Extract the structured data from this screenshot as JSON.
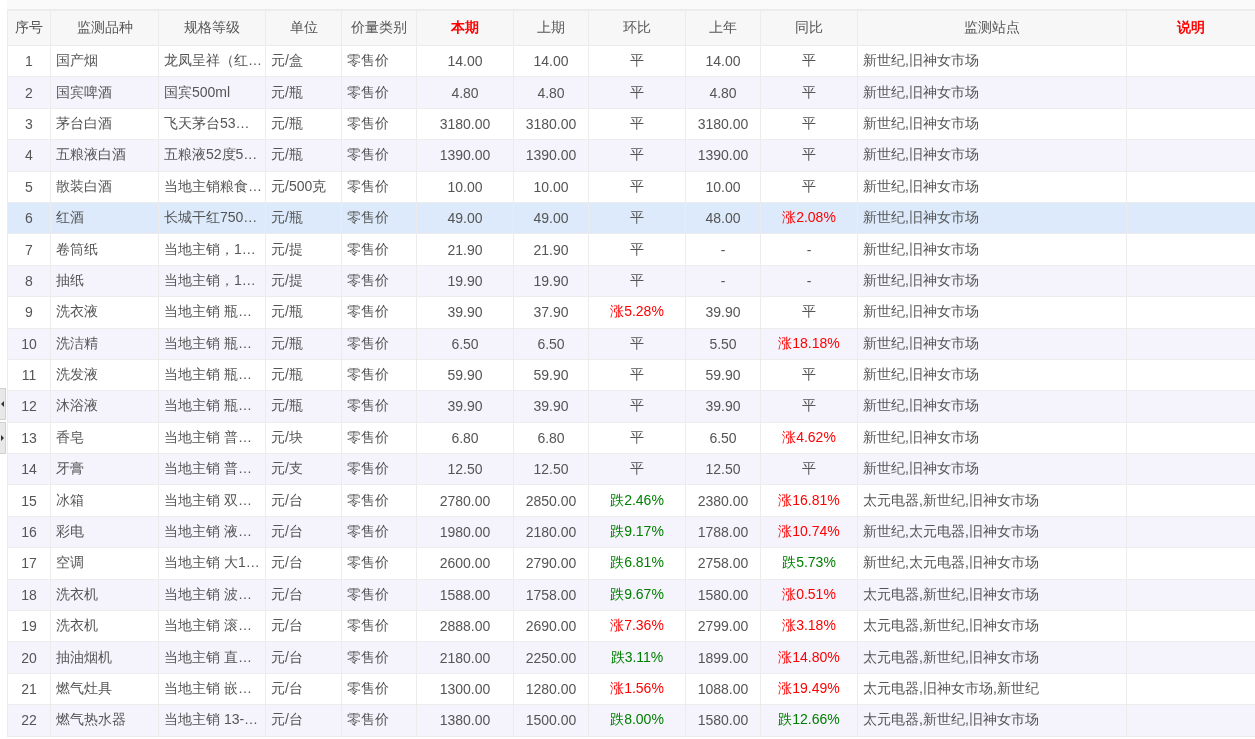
{
  "table": {
    "columns": [
      {
        "label": "序号",
        "emphasized": false
      },
      {
        "label": "监测品种",
        "emphasized": false
      },
      {
        "label": "规格等级",
        "emphasized": false
      },
      {
        "label": "单位",
        "emphasized": false
      },
      {
        "label": "价量类别",
        "emphasized": false
      },
      {
        "label": "本期",
        "emphasized": true
      },
      {
        "label": "上期",
        "emphasized": false
      },
      {
        "label": "环比",
        "emphasized": false
      },
      {
        "label": "上年",
        "emphasized": false
      },
      {
        "label": "同比",
        "emphasized": false
      },
      {
        "label": "监测站点",
        "emphasized": false
      },
      {
        "label": "说明",
        "emphasized": true
      }
    ],
    "rows": [
      {
        "selected": false,
        "cells": [
          "1",
          "国产烟",
          "龙凤呈祥（红…",
          "元/盒",
          "零售价",
          "14.00",
          "14.00",
          {
            "text": "平",
            "kind": "flat"
          },
          "14.00",
          {
            "text": "平",
            "kind": "flat"
          },
          "新世纪,旧神女市场"
        ]
      },
      {
        "selected": false,
        "cells": [
          "2",
          "国宾啤酒",
          "国宾500ml",
          "元/瓶",
          "零售价",
          "4.80",
          "4.80",
          {
            "text": "平",
            "kind": "flat"
          },
          "4.80",
          {
            "text": "平",
            "kind": "flat"
          },
          "新世纪,旧神女市场"
        ]
      },
      {
        "selected": false,
        "cells": [
          "3",
          "茅台白酒",
          "飞天茅台53…",
          "元/瓶",
          "零售价",
          "3180.00",
          "3180.00",
          {
            "text": "平",
            "kind": "flat"
          },
          "3180.00",
          {
            "text": "平",
            "kind": "flat"
          },
          "新世纪,旧神女市场"
        ]
      },
      {
        "selected": false,
        "cells": [
          "4",
          "五粮液白酒",
          "五粮液52度5…",
          "元/瓶",
          "零售价",
          "1390.00",
          "1390.00",
          {
            "text": "平",
            "kind": "flat"
          },
          "1390.00",
          {
            "text": "平",
            "kind": "flat"
          },
          "新世纪,旧神女市场"
        ]
      },
      {
        "selected": false,
        "cells": [
          "5",
          "散装白酒",
          "当地主销粮食…",
          "元/500克",
          "零售价",
          "10.00",
          "10.00",
          {
            "text": "平",
            "kind": "flat"
          },
          "10.00",
          {
            "text": "平",
            "kind": "flat"
          },
          "新世纪,旧神女市场"
        ]
      },
      {
        "selected": true,
        "cells": [
          "6",
          "红酒",
          "长城干红750…",
          "元/瓶",
          "零售价",
          "49.00",
          "49.00",
          {
            "text": "平",
            "kind": "flat"
          },
          "48.00",
          {
            "text": "涨2.08%",
            "kind": "up"
          },
          "新世纪,旧神女市场"
        ]
      },
      {
        "selected": false,
        "cells": [
          "7",
          "卷筒纸",
          "当地主销，1…",
          "元/提",
          "零售价",
          "21.90",
          "21.90",
          {
            "text": "平",
            "kind": "flat"
          },
          "-",
          {
            "text": "-",
            "kind": "flat"
          },
          "新世纪,旧神女市场"
        ]
      },
      {
        "selected": false,
        "cells": [
          "8",
          "抽纸",
          "当地主销，1…",
          "元/提",
          "零售价",
          "19.90",
          "19.90",
          {
            "text": "平",
            "kind": "flat"
          },
          "-",
          {
            "text": "-",
            "kind": "flat"
          },
          "新世纪,旧神女市场"
        ]
      },
      {
        "selected": false,
        "cells": [
          "9",
          "洗衣液",
          "当地主销 瓶…",
          "元/瓶",
          "零售价",
          "39.90",
          "37.90",
          {
            "text": "涨5.28%",
            "kind": "up"
          },
          "39.90",
          {
            "text": "平",
            "kind": "flat"
          },
          "新世纪,旧神女市场"
        ]
      },
      {
        "selected": false,
        "cells": [
          "10",
          "洗洁精",
          "当地主销 瓶…",
          "元/瓶",
          "零售价",
          "6.50",
          "6.50",
          {
            "text": "平",
            "kind": "flat"
          },
          "5.50",
          {
            "text": "涨18.18%",
            "kind": "up"
          },
          "新世纪,旧神女市场"
        ]
      },
      {
        "selected": false,
        "cells": [
          "11",
          "洗发液",
          "当地主销 瓶…",
          "元/瓶",
          "零售价",
          "59.90",
          "59.90",
          {
            "text": "平",
            "kind": "flat"
          },
          "59.90",
          {
            "text": "平",
            "kind": "flat"
          },
          "新世纪,旧神女市场"
        ]
      },
      {
        "selected": false,
        "cells": [
          "12",
          "沐浴液",
          "当地主销 瓶…",
          "元/瓶",
          "零售价",
          "39.90",
          "39.90",
          {
            "text": "平",
            "kind": "flat"
          },
          "39.90",
          {
            "text": "平",
            "kind": "flat"
          },
          "新世纪,旧神女市场"
        ]
      },
      {
        "selected": false,
        "cells": [
          "13",
          "香皂",
          "当地主销 普…",
          "元/块",
          "零售价",
          "6.80",
          "6.80",
          {
            "text": "平",
            "kind": "flat"
          },
          "6.50",
          {
            "text": "涨4.62%",
            "kind": "up"
          },
          "新世纪,旧神女市场"
        ]
      },
      {
        "selected": false,
        "cells": [
          "14",
          "牙膏",
          "当地主销 普…",
          "元/支",
          "零售价",
          "12.50",
          "12.50",
          {
            "text": "平",
            "kind": "flat"
          },
          "12.50",
          {
            "text": "平",
            "kind": "flat"
          },
          "新世纪,旧神女市场"
        ]
      },
      {
        "selected": false,
        "cells": [
          "15",
          "冰箱",
          "当地主销 双…",
          "元/台",
          "零售价",
          "2780.00",
          "2850.00",
          {
            "text": "跌2.46%",
            "kind": "down"
          },
          "2380.00",
          {
            "text": "涨16.81%",
            "kind": "up"
          },
          "太元电器,新世纪,旧神女市场"
        ]
      },
      {
        "selected": false,
        "cells": [
          "16",
          "彩电",
          "当地主销 液…",
          "元/台",
          "零售价",
          "1980.00",
          "2180.00",
          {
            "text": "跌9.17%",
            "kind": "down"
          },
          "1788.00",
          {
            "text": "涨10.74%",
            "kind": "up"
          },
          "新世纪,太元电器,旧神女市场"
        ]
      },
      {
        "selected": false,
        "cells": [
          "17",
          "空调",
          "当地主销 大1…",
          "元/台",
          "零售价",
          "2600.00",
          "2790.00",
          {
            "text": "跌6.81%",
            "kind": "down"
          },
          "2758.00",
          {
            "text": "跌5.73%",
            "kind": "down"
          },
          "新世纪,太元电器,旧神女市场"
        ]
      },
      {
        "selected": false,
        "cells": [
          "18",
          "洗衣机",
          "当地主销 波…",
          "元/台",
          "零售价",
          "1588.00",
          "1758.00",
          {
            "text": "跌9.67%",
            "kind": "down"
          },
          "1580.00",
          {
            "text": "涨0.51%",
            "kind": "up"
          },
          "太元电器,新世纪,旧神女市场"
        ]
      },
      {
        "selected": false,
        "cells": [
          "19",
          "洗衣机",
          "当地主销 滚…",
          "元/台",
          "零售价",
          "2888.00",
          "2690.00",
          {
            "text": "涨7.36%",
            "kind": "up"
          },
          "2799.00",
          {
            "text": "涨3.18%",
            "kind": "up"
          },
          "太元电器,新世纪,旧神女市场"
        ]
      },
      {
        "selected": false,
        "cells": [
          "20",
          "抽油烟机",
          "当地主销 直…",
          "元/台",
          "零售价",
          "2180.00",
          "2250.00",
          {
            "text": "跌3.11%",
            "kind": "down"
          },
          "1899.00",
          {
            "text": "涨14.80%",
            "kind": "up"
          },
          "太元电器,新世纪,旧神女市场"
        ]
      },
      {
        "selected": false,
        "cells": [
          "21",
          "燃气灶具",
          "当地主销 嵌…",
          "元/台",
          "零售价",
          "1300.00",
          "1280.00",
          {
            "text": "涨1.56%",
            "kind": "up"
          },
          "1088.00",
          {
            "text": "涨19.49%",
            "kind": "up"
          },
          "太元电器,旧神女市场,新世纪"
        ]
      },
      {
        "selected": false,
        "cells": [
          "22",
          "燃气热水器",
          "当地主销 13-…",
          "元/台",
          "零售价",
          "1380.00",
          "1500.00",
          {
            "text": "跌8.00%",
            "kind": "down"
          },
          "1580.00",
          {
            "text": "跌12.66%",
            "kind": "down"
          },
          "太元电器,新世纪,旧神女市场"
        ]
      }
    ]
  }
}
